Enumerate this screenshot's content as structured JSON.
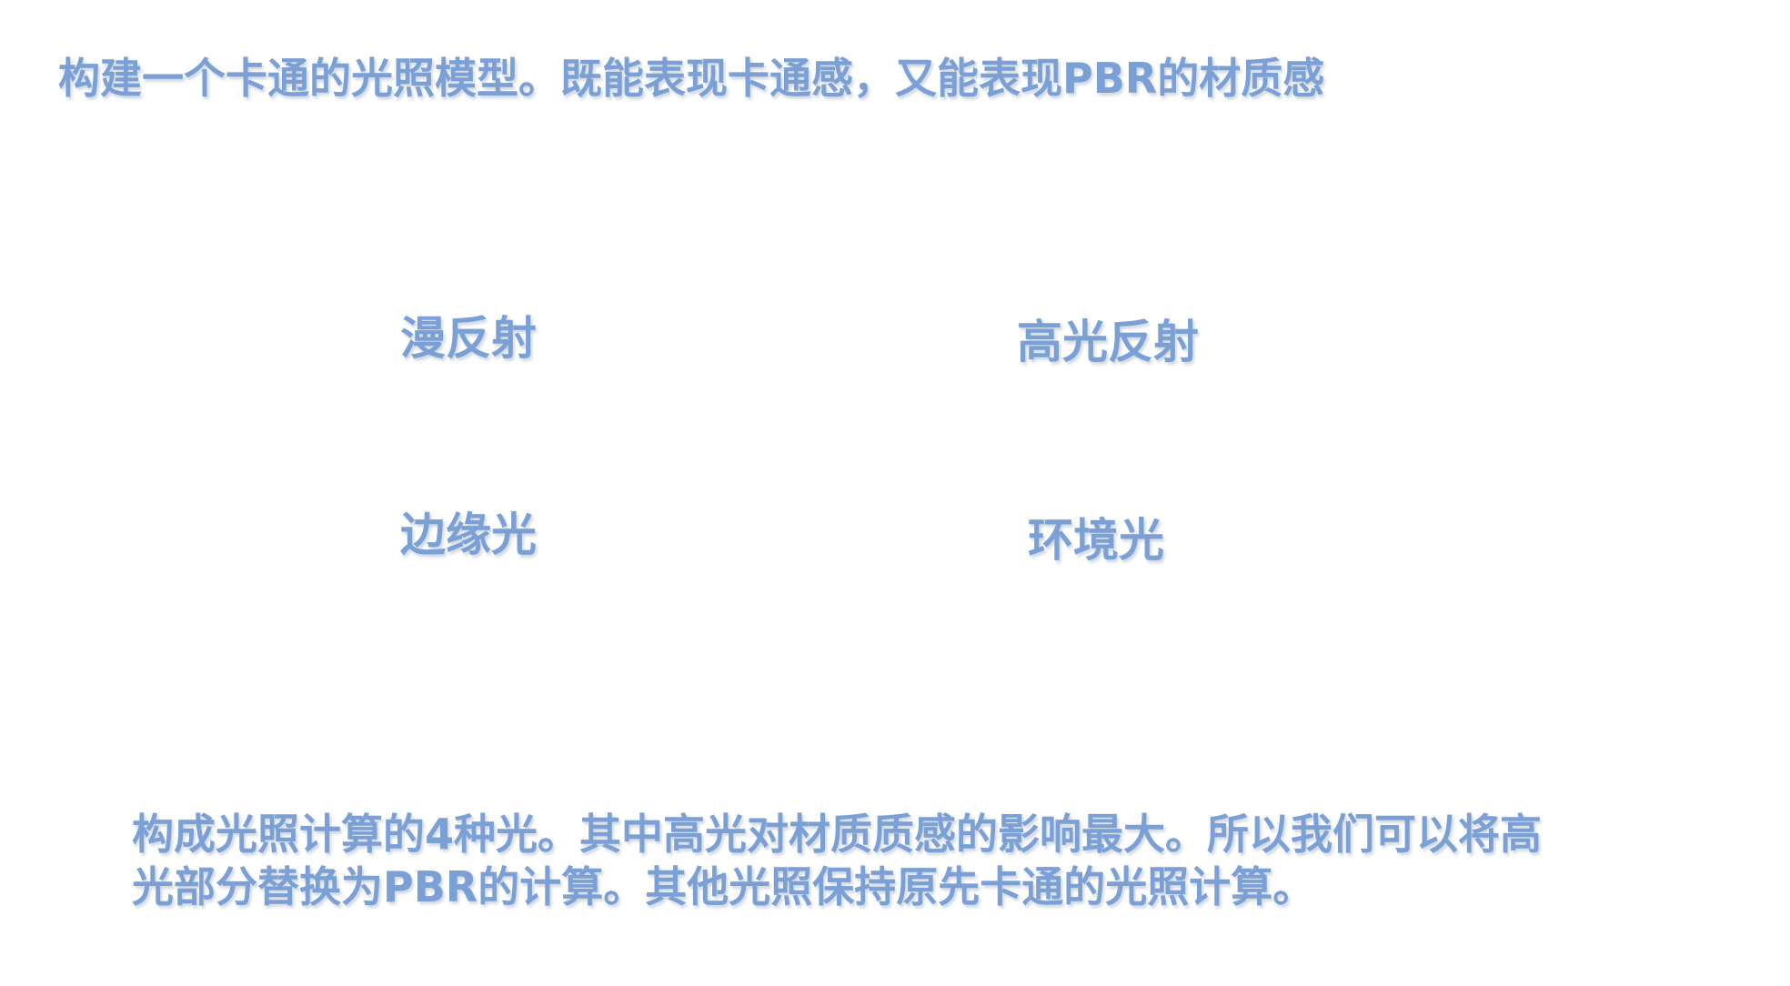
{
  "slide": {
    "title": "构建一个卡通的光照模型。既能表现卡通感，又能表现PBR的材质感",
    "terms": {
      "diffuse": "漫反射",
      "specular": "高光反射",
      "rim": "边缘光",
      "ambient": "环境光"
    },
    "summary": {
      "line1": "构成光照计算的4种光。其中高光对材质质感的影响最大。所以我们可以将高",
      "line2": "光部分替换为PBR的计算。其他光照保持原先卡通的光照计算。"
    },
    "text_color": "#7aa0d6",
    "background_color": "#ffffff"
  }
}
